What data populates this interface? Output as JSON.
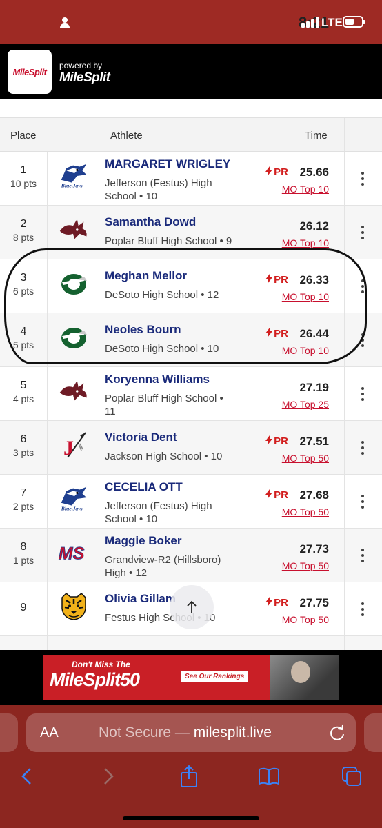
{
  "status_bar": {
    "time": "8:21",
    "network": "LTE"
  },
  "header": {
    "logo_text": "MileSplit",
    "powered_by": "powered by",
    "brand": "MileSplit"
  },
  "table": {
    "columns": {
      "place": "Place",
      "athlete": "Athlete",
      "time": "Time"
    },
    "rows": [
      {
        "place": "1",
        "points": "10 pts",
        "name": "MARGARET WRIGLEY",
        "school_line1": "Jefferson (Festus) High",
        "school_line2": "School • 10",
        "pr": "PR",
        "time": "25.66",
        "rank": "MO Top 10",
        "logo": "bluejays-logo"
      },
      {
        "place": "2",
        "points": "8 pts",
        "name": "Samantha Dowd",
        "school_line1": "Poplar Bluff High School • 9",
        "school_line2": "",
        "pr": "",
        "time": "26.12",
        "rank": "MO Top 10",
        "logo": "mules-logo"
      },
      {
        "place": "3",
        "points": "6 pts",
        "name": "Meghan Mellor",
        "school_line1": "DeSoto High School • 12",
        "school_line2": "",
        "pr": "PR",
        "time": "26.33",
        "rank": "MO Top 10",
        "logo": "desoto-logo"
      },
      {
        "place": "4",
        "points": "5 pts",
        "name": "Neoles Bourn",
        "school_line1": "DeSoto High School • 10",
        "school_line2": "",
        "pr": "PR",
        "time": "26.44",
        "rank": "MO Top 10",
        "logo": "desoto-logo"
      },
      {
        "place": "5",
        "points": "4 pts",
        "name": "Koryenna Williams",
        "school_line1": "Poplar Bluff High School •",
        "school_line2": "11",
        "pr": "",
        "time": "27.19",
        "rank": "MO Top 25",
        "logo": "mules-logo"
      },
      {
        "place": "6",
        "points": "3 pts",
        "name": "Victoria Dent",
        "school_line1": "Jackson High School • 10",
        "school_line2": "",
        "pr": "PR",
        "time": "27.51",
        "rank": "MO Top 50",
        "logo": "jackson-logo"
      },
      {
        "place": "7",
        "points": "2 pts",
        "name": "CECELIA OTT",
        "school_line1": "Jefferson (Festus) High",
        "school_line2": "School • 10",
        "pr": "PR",
        "time": "27.68",
        "rank": "MO Top 50",
        "logo": "bluejays-logo"
      },
      {
        "place": "8",
        "points": "1 pts",
        "name": "Maggie Boker",
        "school_line1": "Grandview-R2 (Hillsboro)",
        "school_line2": "High • 12",
        "pr": "",
        "time": "27.73",
        "rank": "MO Top 50",
        "logo": "ms-logo"
      },
      {
        "place": "9",
        "points": "",
        "name": "Olivia Gillam",
        "school_line1": "Festus High School • 10",
        "school_line2": "",
        "pr": "PR",
        "time": "27.75",
        "rank": "MO Top 50",
        "logo": "tiger-logo"
      }
    ]
  },
  "logos": {
    "ms_text": "MS"
  },
  "ad": {
    "line1": "Don't Miss The",
    "line2": "MileSplit50",
    "button": "See Our Rankings"
  },
  "browser": {
    "aa": "AA",
    "not_secure": "Not Secure —",
    "domain": "milesplit.live"
  },
  "colors": {
    "brand_red": "#c8102e",
    "name_blue": "#1a2a7a",
    "status_bar": "#9e2a24",
    "safari_bar": "#8c2620"
  }
}
